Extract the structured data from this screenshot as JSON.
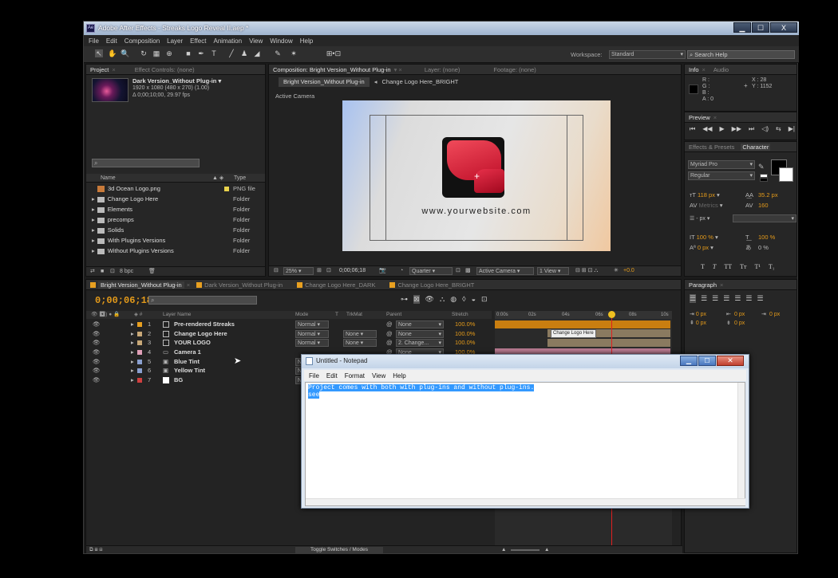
{
  "window": {
    "title": "Adobe After Effects - Streaks Logo Reveal II.aep *",
    "btn_min": "▁",
    "btn_max": "☐",
    "btn_close": "X"
  },
  "menu": [
    "File",
    "Edit",
    "Composition",
    "Layer",
    "Effect",
    "Animation",
    "View",
    "Window",
    "Help"
  ],
  "toolbar": {
    "workspace_label": "Workspace:",
    "workspace_value": "Standard",
    "search_placeholder": "Search Help"
  },
  "project_panel": {
    "tab_project": "Project",
    "tab_effect_controls": "Effect Controls: (none)",
    "item_name": "Dark Version_Without Plug-in ▾",
    "item_size": "1920 x 1080  (480 x 270) (1.00)",
    "item_duration": "Δ 0;00;10;00, 29.97 fps",
    "col_name": "Name",
    "col_type": "Type",
    "items": [
      {
        "name": "3d Ocean Logo.png",
        "type": "PNG file",
        "color": "#8f86c8"
      },
      {
        "name": "Change Logo Here",
        "type": "Folder",
        "color": "#e8d24c"
      },
      {
        "name": "Elements",
        "type": "Folder",
        "color": "#e8d24c"
      },
      {
        "name": "precomps",
        "type": "Folder",
        "color": "#e8d24c"
      },
      {
        "name": "Solids",
        "type": "Folder",
        "color": "#e8d24c"
      },
      {
        "name": "With Plugins Versions",
        "type": "Folder",
        "color": "#e8d24c"
      },
      {
        "name": "Without Plugins Versions",
        "type": "Folder",
        "color": "#e8d24c"
      }
    ],
    "bpc": "8 bpc"
  },
  "comp_panel": {
    "tab_comp": "Composition: Bright Version_Without Plug-in",
    "tab_layer": "Layer: (none)",
    "tab_footage": "Footage: (none)",
    "crumb1": "Bright Version_Without Plug-in",
    "crumb2": "Change Logo Here_BRIGHT",
    "camera_label": "Active Camera",
    "website": "www.yourwebsite.com",
    "zoom": "25%",
    "timecode": "0;00;06;18",
    "quality": "Quarter",
    "view_camera": "Active Camera",
    "view_count": "1 View",
    "exposure": "+0.0"
  },
  "info_panel": {
    "tab_info": "Info",
    "tab_audio": "Audio",
    "r": "R :",
    "g": "G :",
    "b": "B :",
    "a": "A : 0",
    "x": "X : 28",
    "y": "Y : 1152"
  },
  "preview_panel": {
    "tab": "Preview"
  },
  "character_panel": {
    "tab_effects": "Effects & Presets",
    "tab_char": "Character",
    "font": "Myriad Pro",
    "style": "Regular",
    "size": "118 px",
    "leading": "35.2 px",
    "kerning": "Metrics",
    "tracking": "160",
    "stroke": "- px",
    "vscale": "100 %",
    "hscale": "100 %",
    "baseline": "0 px",
    "tsume": "0 %"
  },
  "paragraph_panel": {
    "tab": "Paragraph",
    "indent1": "0 px",
    "indent2": "0 px",
    "indent3": "0 px",
    "space1": "0 px",
    "space2": "0 px"
  },
  "timeline": {
    "tabs": [
      "Bright Version_Without Plug-in",
      "Dark Version_Without Plug-in",
      "Change Logo Here_DARK",
      "Change Logo Here_BRIGHT"
    ],
    "timecode": "0;00;06;18",
    "col_layer": "Layer Name",
    "col_mode": "Mode",
    "col_t": "T",
    "col_trkmat": "TrkMat",
    "col_parent": "Parent",
    "col_stretch": "Stretch",
    "layers": [
      {
        "num": "1",
        "name": "Pre-rendered Streaks",
        "mode": "Normal",
        "trk": "",
        "parent": "None",
        "stretch": "100.0%",
        "color": "#e8a020"
      },
      {
        "num": "2",
        "name": "Change Logo Here",
        "mode": "Normal",
        "trk": "None",
        "parent": "None",
        "stretch": "100.0%",
        "color": "#c8a878"
      },
      {
        "num": "3",
        "name": "YOUR LOGO",
        "mode": "Normal",
        "trk": "None",
        "parent": "2. Change...",
        "stretch": "100.0%",
        "color": "#c8a878"
      },
      {
        "num": "4",
        "name": "Camera 1",
        "mode": "",
        "trk": "",
        "parent": "None",
        "stretch": "100.0%",
        "color": "#e0a0b8"
      },
      {
        "num": "5",
        "name": "Blue Tint",
        "mode": "N",
        "trk": "",
        "parent": "",
        "stretch": "",
        "color": "#8aa0d0"
      },
      {
        "num": "6",
        "name": "Yellow Tint",
        "mode": "N",
        "trk": "",
        "parent": "",
        "stretch": "",
        "color": "#8aa0d0"
      },
      {
        "num": "7",
        "name": "BG",
        "mode": "N",
        "trk": "",
        "parent": "",
        "stretch": "",
        "color": "#d04040"
      }
    ],
    "ruler": [
      "0:00s",
      "02s",
      "04s",
      "06s",
      "08s",
      "10s"
    ],
    "clip_label": "Change Logo Here",
    "toggle": "Toggle Switches / Modes"
  },
  "notepad": {
    "title": "Untitled - Notepad",
    "menu": [
      "File",
      "Edit",
      "Format",
      "View",
      "Help"
    ],
    "line1": "Project comes with both with plug-ins and without plug-ins.",
    "line2": "see"
  }
}
